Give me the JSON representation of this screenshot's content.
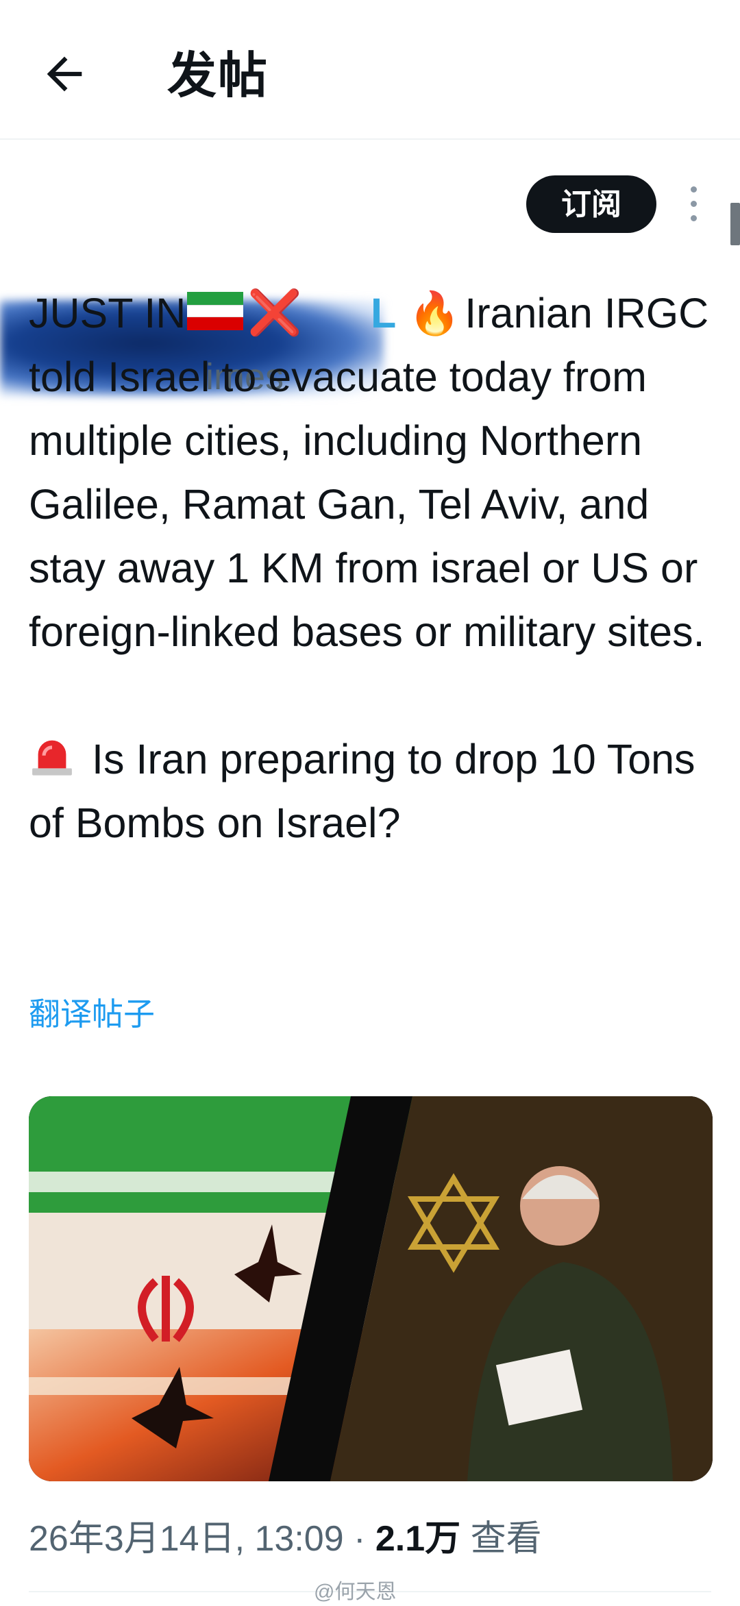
{
  "header": {
    "title": "发帖"
  },
  "author": {
    "handle_fragment": "imes"
  },
  "subscribe_label": "订阅",
  "tweet": {
    "line_prefix": "JUST IN",
    "line_suffix": "Iranian",
    "body_rest": "IRGC told Israel to evacuate today from multiple cities, including Northern Galilee, Ramat Gan, Tel Aviv, and stay away 1 KM from israel or US or foreign-linked bases or military sites.",
    "cross": "❌",
    "l_glyph": "L",
    "fire": "🔥",
    "question": "Is Iran preparing to drop 10 Tons of Bombs on Israel?"
  },
  "translate_label": "翻译帖子",
  "meta": {
    "date": "26年3月14日, 13:09",
    "separator": "·",
    "views": "2.1万",
    "views_label": "查看"
  },
  "watermark": "@何天恩",
  "icons": {
    "back": "arrow-left-icon",
    "more": "more-vertical-icon",
    "flag": "iran-flag-icon",
    "siren": "siren-icon"
  },
  "colors": {
    "link": "#1d9bf0",
    "secondary_text": "#536471",
    "subscribe_bg": "#0f1419"
  }
}
